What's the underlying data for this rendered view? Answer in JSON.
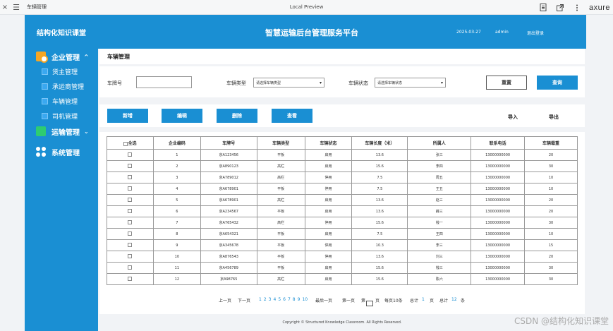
{
  "browser": {
    "close": "×",
    "menu": "☰",
    "tab_title": "车辆管理",
    "center_title": "Local Preview",
    "brand": "axure"
  },
  "sidebar": {
    "brand": "结构化知识课堂",
    "groups": [
      {
        "label": "企业管理",
        "chevron": "^",
        "icon": "company-icon",
        "icon_color": "#f5a623"
      },
      {
        "label": "运输管理",
        "chevron": "⌄",
        "icon": "truck-icon",
        "icon_color": "#2ecc71"
      },
      {
        "label": "系统管理",
        "chevron": "",
        "icon": "apps-icon",
        "icon_color": "#ffffff"
      }
    ],
    "sub_items": [
      "货主管理",
      "承运商管理",
      "车辆管理",
      "司机管理"
    ]
  },
  "header": {
    "title": "智慧运输后台管理服务平台",
    "date": "2025-03-27",
    "user": "admin",
    "logout": "退出登录"
  },
  "page": {
    "title": "车辆管理"
  },
  "filter": {
    "plate_label": "车牌号",
    "plate_value": "",
    "type_label": "车辆类型",
    "type_value": "请选择车辆类型",
    "status_label": "车辆状态",
    "status_value": "请选择车辆状态",
    "reset": "重置",
    "query": "查询"
  },
  "actions": {
    "add": "新增",
    "edit": "编辑",
    "delete": "删除",
    "view": "查看",
    "import": "导入",
    "export": "导出"
  },
  "table": {
    "headers": [
      "全选",
      "企业编码",
      "车牌号",
      "车辆类型",
      "车辆状态",
      "车辆长度（米）",
      "所属人",
      "联系电话",
      "车辆载重"
    ],
    "rows": [
      [
        "1",
        "京A123456",
        "平板",
        "启用",
        "13.6",
        "张三",
        "13000000000",
        "20"
      ],
      [
        "2",
        "京A890123",
        "高栏",
        "启用",
        "15.6",
        "李四",
        "13000000000",
        "30"
      ],
      [
        "3",
        "京A789012",
        "高栏",
        "停用",
        "7.5",
        "周五",
        "13000000000",
        "10"
      ],
      [
        "4",
        "京A678901",
        "平板",
        "停用",
        "7.5",
        "王五",
        "13000000000",
        "10"
      ],
      [
        "5",
        "京A678901",
        "高栏",
        "启用",
        "13.6",
        "赵三",
        "13000000000",
        "20"
      ],
      [
        "6",
        "京A234567",
        "平板",
        "启用",
        "13.6",
        "薛三",
        "13000000000",
        "20"
      ],
      [
        "7",
        "京A765432",
        "高栏",
        "停用",
        "15.6",
        "钱一",
        "13000000000",
        "30"
      ],
      [
        "8",
        "京A654321",
        "平板",
        "启用",
        "7.5",
        "王四",
        "13000000000",
        "10"
      ],
      [
        "9",
        "京A345678",
        "平板",
        "停用",
        "10.3",
        "李三",
        "13000000000",
        "15"
      ],
      [
        "10",
        "京A876543",
        "平板",
        "停用",
        "13.6",
        "刘三",
        "13000000000",
        "20"
      ],
      [
        "11",
        "京A456789",
        "平板",
        "启用",
        "15.6",
        "钱三",
        "13000000000",
        "30"
      ],
      [
        "12",
        "京A98765",
        "高栏",
        "启用",
        "15.6",
        "陈六",
        "13000000000",
        "30"
      ]
    ]
  },
  "pager": {
    "prev": "上一页",
    "next": "下一页",
    "pages": [
      "1",
      "2",
      "3",
      "4",
      "5",
      "6",
      "7",
      "8",
      "9",
      "10"
    ],
    "last": "最后一页",
    "first": "第一页",
    "goto_prefix": "第",
    "goto_suffix": "页",
    "per_page": "每页10条",
    "total_label": "总计",
    "total_pages": "1",
    "total_pages_unit": "页",
    "total_records_label": "总计",
    "total_records": "12",
    "total_records_unit": "条"
  },
  "footer": {
    "copyright": "Copyright © Structured Knowledge Classroom. All Rights Reserved."
  },
  "watermark": "CSDN @结构化知识课堂"
}
